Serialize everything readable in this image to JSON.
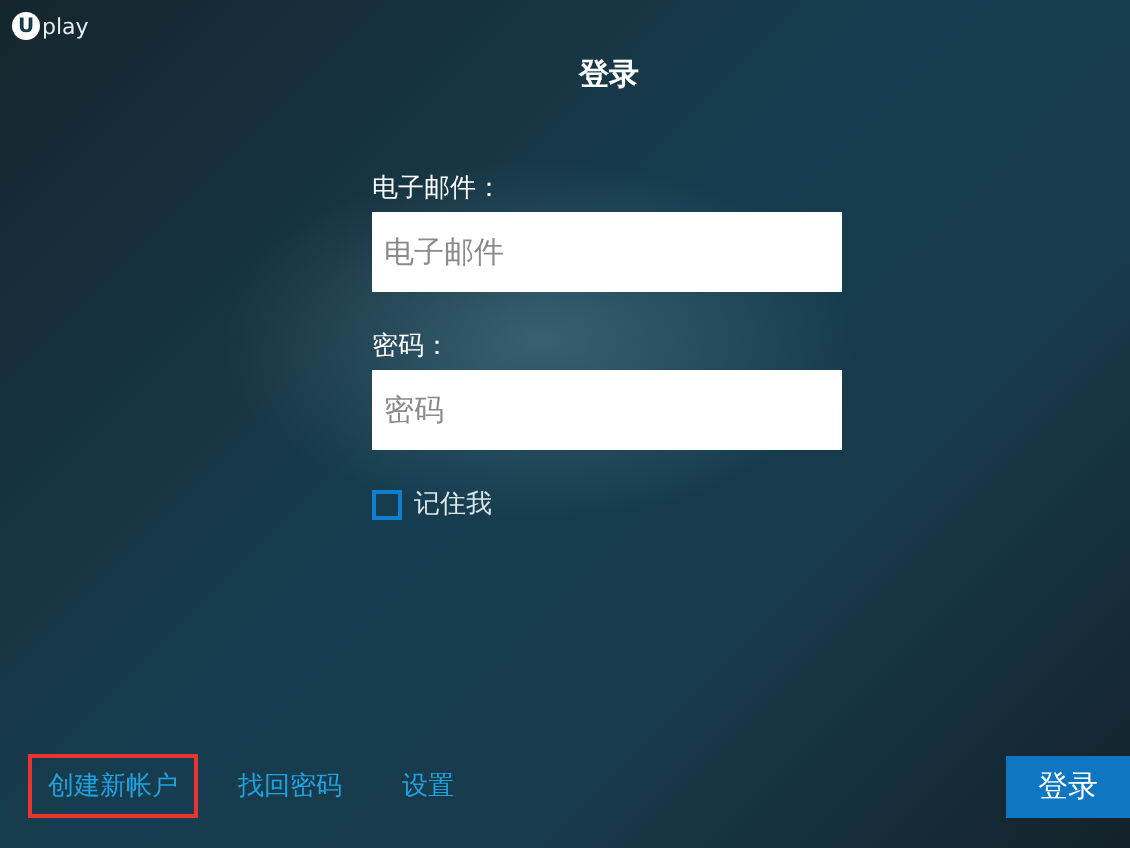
{
  "logo": {
    "mark": "U",
    "text": "play"
  },
  "title": "登录",
  "fields": [
    {
      "label": "电子邮件：",
      "placeholder": "电子邮件"
    },
    {
      "label": "密码：",
      "placeholder": "密码"
    }
  ],
  "remember": {
    "label": "记住我",
    "checked": false
  },
  "links": [
    {
      "label": "创建新帐户",
      "highlighted": true
    },
    {
      "label": "找回密码",
      "highlighted": false
    },
    {
      "label": "设置",
      "highlighted": false
    }
  ],
  "login_button": "登录"
}
